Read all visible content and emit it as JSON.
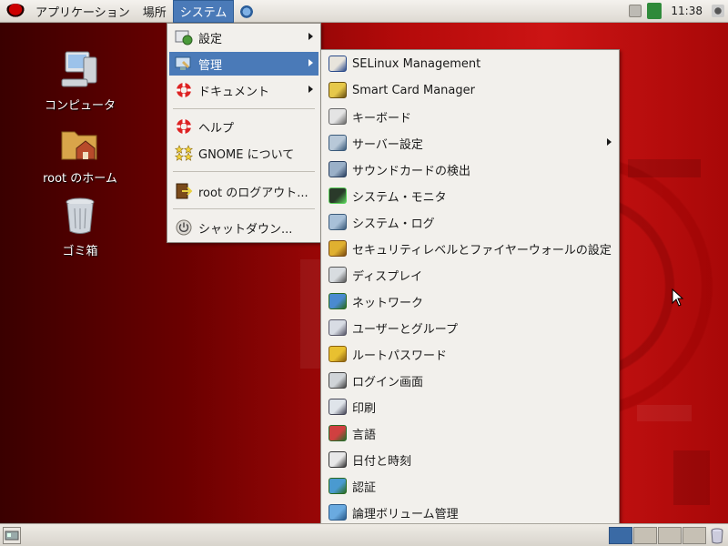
{
  "top_panel": {
    "menus": {
      "applications": "アプリケーション",
      "places": "場所",
      "system": "システム"
    },
    "clock": "11:38"
  },
  "desktop_icons": {
    "computer": "コンピュータ",
    "home": "root のホーム",
    "trash": "ゴミ箱"
  },
  "system_menu": {
    "preferences": "設定",
    "administration": "管理",
    "documentation": "ドキュメント",
    "help": "ヘルプ",
    "about_gnome": "GNOME について",
    "logout": "root のログアウト...",
    "shutdown": "シャットダウン..."
  },
  "admin_menu": {
    "items": [
      {
        "label": "SELinux Management",
        "icon": "selinux-icon"
      },
      {
        "label": "Smart Card Manager",
        "icon": "smartcard-icon"
      },
      {
        "label": "キーボード",
        "icon": "keyboard-icon"
      },
      {
        "label": "サーバー設定",
        "icon": "server-icon"
      },
      {
        "label": "サウンドカードの検出",
        "icon": "sound-icon"
      },
      {
        "label": "システム・モニタ",
        "icon": "monitor-icon"
      },
      {
        "label": "システム・ログ",
        "icon": "log-icon"
      },
      {
        "label": "セキュリティレベルとファイヤーウォールの設定",
        "icon": "firewall-icon"
      },
      {
        "label": "ディスプレイ",
        "icon": "display-icon"
      },
      {
        "label": "ネットワーク",
        "icon": "network-icon"
      },
      {
        "label": "ユーザーとグループ",
        "icon": "users-icon"
      },
      {
        "label": "ルートパスワード",
        "icon": "password-icon"
      },
      {
        "label": "ログイン画面",
        "icon": "login-icon"
      },
      {
        "label": "印刷",
        "icon": "printer-icon"
      },
      {
        "label": "言語",
        "icon": "language-icon"
      },
      {
        "label": "日付と時刻",
        "icon": "clock-icon"
      },
      {
        "label": "認証",
        "icon": "auth-icon"
      },
      {
        "label": "論理ボリューム管理",
        "icon": "lvm-icon"
      }
    ]
  },
  "colors": {
    "highlight": "#4a7ab8",
    "menu_bg": "#f2f0ec",
    "wallpaper_red": "#cc1414"
  }
}
